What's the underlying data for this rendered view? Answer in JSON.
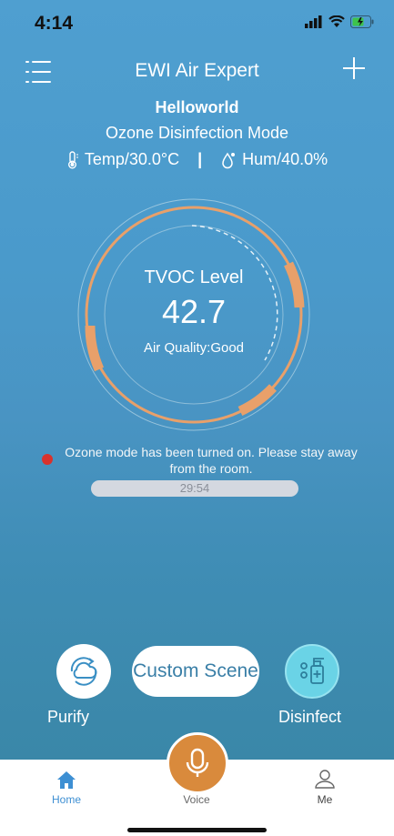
{
  "status_bar": {
    "time": "4:14"
  },
  "header": {
    "title": "EWI Air Expert"
  },
  "device": {
    "name": "Helloworld",
    "mode": "Ozone Disinfection Mode",
    "temperature": "Temp/30.0°C",
    "separator": "|",
    "humidity": "Hum/40.0%"
  },
  "gauge": {
    "label": "TVOC Level",
    "value": "42.7",
    "air_quality": "Air Quality:Good",
    "accent_color": "#e8a06a"
  },
  "alert": {
    "message": "Ozone mode has been turned on. Please stay away from the room.",
    "timer": "29:54"
  },
  "actions": {
    "purify_label": "Purify",
    "custom_scene_label": "Custom Scene",
    "disinfect_label": "Disinfect"
  },
  "tabbar": {
    "home": "Home",
    "voice": "Voice",
    "me": "Me"
  }
}
